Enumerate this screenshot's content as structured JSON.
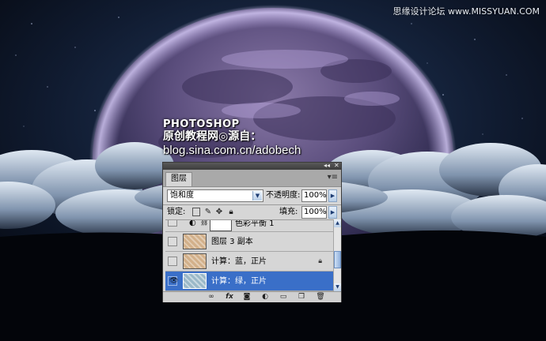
{
  "watermark": "思缘设计论坛 www.MISSYUAN.COM",
  "credit": {
    "line1": "PHOTOSHOP",
    "line2": "原创教程网◎源自：",
    "line3": "blog.sina.com.cn/adobech"
  },
  "layers_panel": {
    "tab_label": "图层",
    "menu_icon": "panel-menu-icon",
    "blend_mode": "饱和度",
    "opacity_label": "不透明度:",
    "opacity_value": "100%",
    "lock_label": "锁定:",
    "fill_label": "填充:",
    "fill_value": "100%",
    "layers": [
      {
        "name": "色彩平衡 1",
        "visible": false,
        "type": "adjustment"
      },
      {
        "name": "图层 3 副本",
        "visible": false,
        "type": "pixel"
      },
      {
        "name": "计算：蓝，正片",
        "visible": false,
        "type": "pixel",
        "locked": true
      },
      {
        "name": "计算：绿，正片",
        "visible": true,
        "type": "pixel",
        "selected": true
      }
    ],
    "bottom_icons": [
      "link-icon",
      "fx-icon",
      "mask-icon",
      "adjustment-icon",
      "group-icon",
      "new-layer-icon",
      "trash-icon"
    ]
  },
  "colors": {
    "selected_row": "#3a6fc8",
    "panel_bg": "#d6d6d6"
  }
}
